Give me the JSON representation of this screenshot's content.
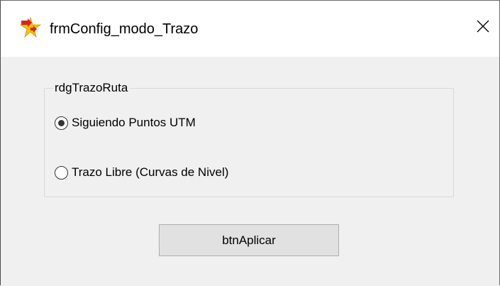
{
  "window": {
    "title": "frmConfig_modo_Trazo",
    "icon": "star-arrow-app-icon",
    "close_label": "×"
  },
  "group": {
    "caption": "rdgTrazoRuta",
    "options": [
      {
        "label": "Siguiendo Puntos UTM",
        "selected": true
      },
      {
        "label": "Trazo Libre (Curvas de Nivel)",
        "selected": false
      }
    ]
  },
  "actions": {
    "apply_label": "btnAplicar"
  },
  "colors": {
    "client_background": "#f0f0f0",
    "titlebar_background": "#ffffff",
    "button_face": "#e1e1e1",
    "button_border": "#adadad",
    "icon_yellow": "#f5c400",
    "icon_red": "#e02020"
  }
}
